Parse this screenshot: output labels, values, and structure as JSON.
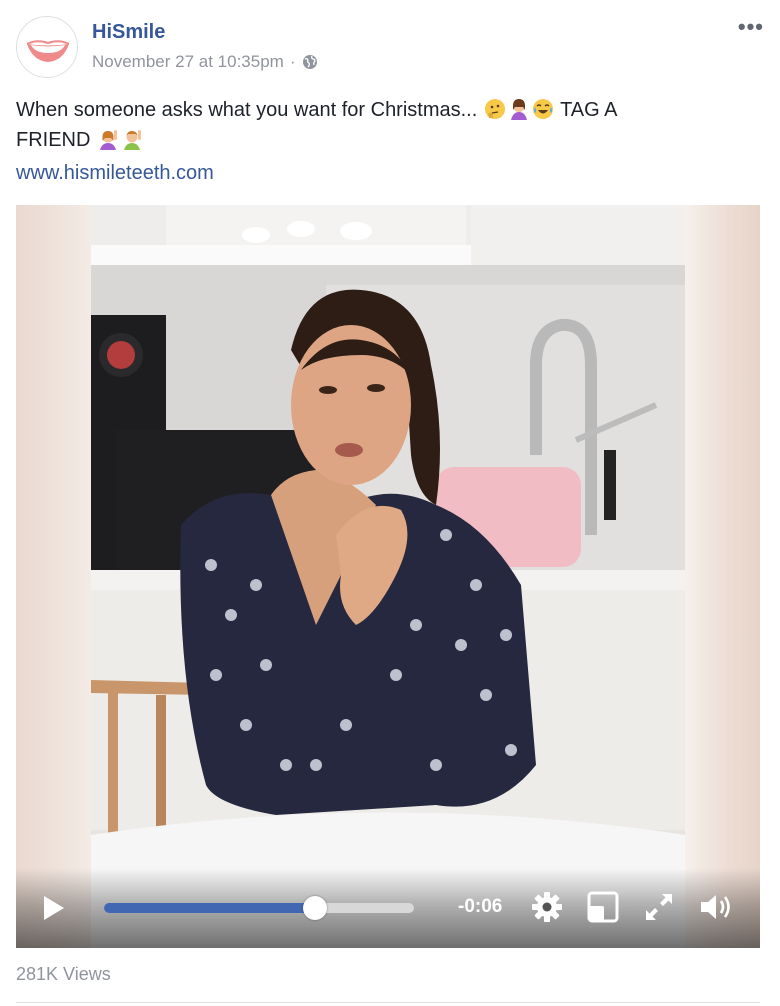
{
  "post": {
    "page_name": "HiSmile",
    "timestamp": "November 27 at 10:35pm",
    "separator": "·",
    "privacy_icon": "globe-icon",
    "more_icon": "more-options-icon",
    "avatar_icon": "smile-lips-logo",
    "caption_text": "When someone asks what you want for Christmas...",
    "caption_tag": "TAG A",
    "caption_friend": "FRIEND",
    "emojis_line1": [
      "thinking-face",
      "woman-tipping-hand",
      "face-with-tears-of-joy"
    ],
    "emojis_line2": [
      "woman-raising-hand",
      "man-raising-hand"
    ],
    "link": "www.hismileteeth.com"
  },
  "video": {
    "play_icon": "play-icon",
    "progress": 0.68,
    "time_remaining": "-0:06",
    "settings_icon": "gear-icon",
    "pip_icon": "picture-in-picture-icon",
    "fullscreen_icon": "fullscreen-icon",
    "volume_icon": "volume-icon"
  },
  "footer": {
    "views": "281K Views"
  },
  "colors": {
    "link": "#365899",
    "meta": "#90949c",
    "progress": "#4267b2"
  }
}
